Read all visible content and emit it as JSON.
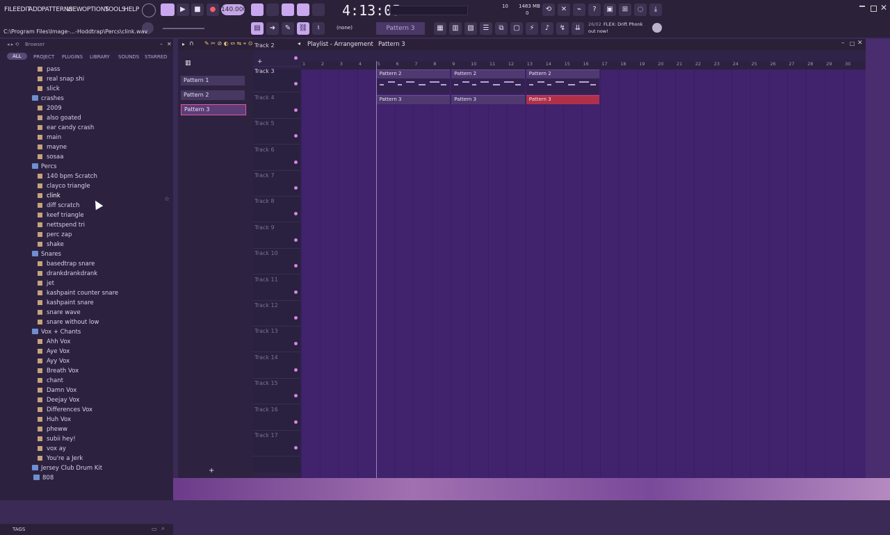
{
  "menu": [
    "FILE",
    "EDIT",
    "ADD",
    "PATTERNS",
    "VIEW",
    "OPTIONS",
    "TOOLS",
    "HELP"
  ],
  "transport": {
    "tempo": "140.000",
    "time": "4:13:05",
    "pattern_selector": "Pattern 3",
    "snap": "(none)",
    "cpu": "10",
    "ram": "1483 MB",
    "poly": "0"
  },
  "news": {
    "date": "26/02",
    "line1": "FLEX: Drift Phonk",
    "line2": "out now!"
  },
  "filepath": "C:\\Program Files\\Image-...-Hoddtrap\\Percs\\clink.wav",
  "browser": {
    "title": "Browser",
    "tabs": [
      "ALL",
      "PROJECT",
      "PLUGINS",
      "LIBRARY",
      "SOUNDS",
      "STARRED"
    ],
    "tags_label": "TAGS",
    "tree": [
      {
        "t": "file",
        "label": "pass"
      },
      {
        "t": "file",
        "label": "real snap shi"
      },
      {
        "t": "file",
        "label": "slick"
      },
      {
        "t": "folder",
        "label": "crashes"
      },
      {
        "t": "file",
        "label": "2009"
      },
      {
        "t": "file",
        "label": "also goated"
      },
      {
        "t": "file",
        "label": "ear candy crash"
      },
      {
        "t": "file",
        "label": "main"
      },
      {
        "t": "file",
        "label": "mayne"
      },
      {
        "t": "file",
        "label": "sosaa"
      },
      {
        "t": "folder",
        "label": "Percs"
      },
      {
        "t": "file",
        "label": "140 bpm Scratch"
      },
      {
        "t": "file",
        "label": "clayco triangle"
      },
      {
        "t": "file",
        "label": "clink",
        "selected": true
      },
      {
        "t": "file",
        "label": "diff scratch"
      },
      {
        "t": "file",
        "label": "keef triangle"
      },
      {
        "t": "file",
        "label": "nettspend tri"
      },
      {
        "t": "file",
        "label": "perc zap"
      },
      {
        "t": "file",
        "label": "shake"
      },
      {
        "t": "folder",
        "label": "Snares"
      },
      {
        "t": "file",
        "label": "basedtrap snare"
      },
      {
        "t": "file",
        "label": "drankdrankdrank"
      },
      {
        "t": "file",
        "label": "jet"
      },
      {
        "t": "file",
        "label": "kashpaint counter snare"
      },
      {
        "t": "file",
        "label": "kashpaint snare"
      },
      {
        "t": "file",
        "label": "snare wave"
      },
      {
        "t": "file",
        "label": "snare without low"
      },
      {
        "t": "folder",
        "label": "Vox + Chants"
      },
      {
        "t": "file",
        "label": "Ahh Vox"
      },
      {
        "t": "file",
        "label": "Aye Vox"
      },
      {
        "t": "file",
        "label": "Ayy Vox"
      },
      {
        "t": "file",
        "label": "Breath Vox"
      },
      {
        "t": "file",
        "label": "chant"
      },
      {
        "t": "file",
        "label": "Damn Vox"
      },
      {
        "t": "file",
        "label": "Deejay Vox"
      },
      {
        "t": "file",
        "label": "Differences Vox"
      },
      {
        "t": "file",
        "label": "Huh Vox"
      },
      {
        "t": "file",
        "label": "pheww"
      },
      {
        "t": "file",
        "label": "subii hey!"
      },
      {
        "t": "file",
        "label": "vox ay"
      },
      {
        "t": "file",
        "label": "You're a Jerk"
      },
      {
        "t": "folder",
        "label": "Jersey Club Drum Kit"
      },
      {
        "t": "subfolder",
        "label": "808"
      }
    ]
  },
  "playlist": {
    "title": "Playlist - Arrangement",
    "current_pattern": "Pattern 3",
    "patterns": [
      "Pattern 1",
      "Pattern 2",
      "Pattern 3"
    ],
    "tracks": [
      "Track 2",
      "Track 3",
      "Track 4",
      "Track 5",
      "Track 6",
      "Track 7",
      "Track 8",
      "Track 9",
      "Track 10",
      "Track 11",
      "Track 12",
      "Track 13",
      "Track 14",
      "Track 15",
      "Track 16",
      "Track 17"
    ],
    "ruler": [
      "1",
      "2",
      "3",
      "4",
      "5",
      "6",
      "7",
      "8",
      "9",
      "10",
      "11",
      "12",
      "13",
      "14",
      "15",
      "16",
      "17",
      "18",
      "19",
      "20",
      "21",
      "22",
      "23",
      "24",
      "25",
      "26",
      "27",
      "28",
      "29",
      "30"
    ],
    "clips_track2": [
      "Pattern 2",
      "Pattern 2",
      "Pattern 2"
    ],
    "clips_track3": [
      "Pattern 3",
      "Pattern 3",
      "Pattern 3"
    ]
  },
  "colors": {
    "accent": "#c9a8ef",
    "grid": "#40226d",
    "active_clip": "#b0304a"
  }
}
